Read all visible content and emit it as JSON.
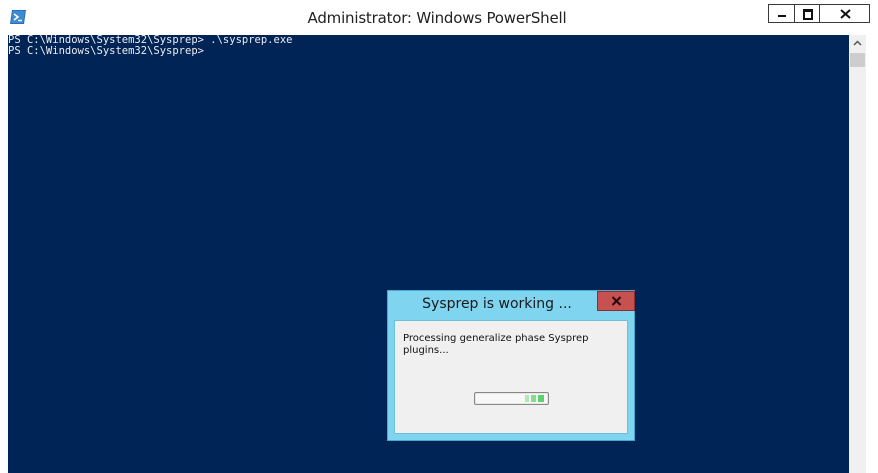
{
  "window": {
    "title": "Administrator: Windows PowerShell",
    "icon": "powershell-icon"
  },
  "console": {
    "lines": [
      "PS C:\\Windows\\System32\\Sysprep> .\\sysprep.exe",
      "PS C:\\Windows\\System32\\Sysprep>"
    ],
    "background": "#012456",
    "foreground": "#eeedf0"
  },
  "dialog": {
    "title": "Sysprep is working ...",
    "message": "Processing generalize phase Sysprep plugins...",
    "close_icon": "close-icon",
    "title_color": "#7fd4f0",
    "close_color": "#c75050",
    "progress_style": "marquee",
    "progress_color": "#5fd36b"
  }
}
